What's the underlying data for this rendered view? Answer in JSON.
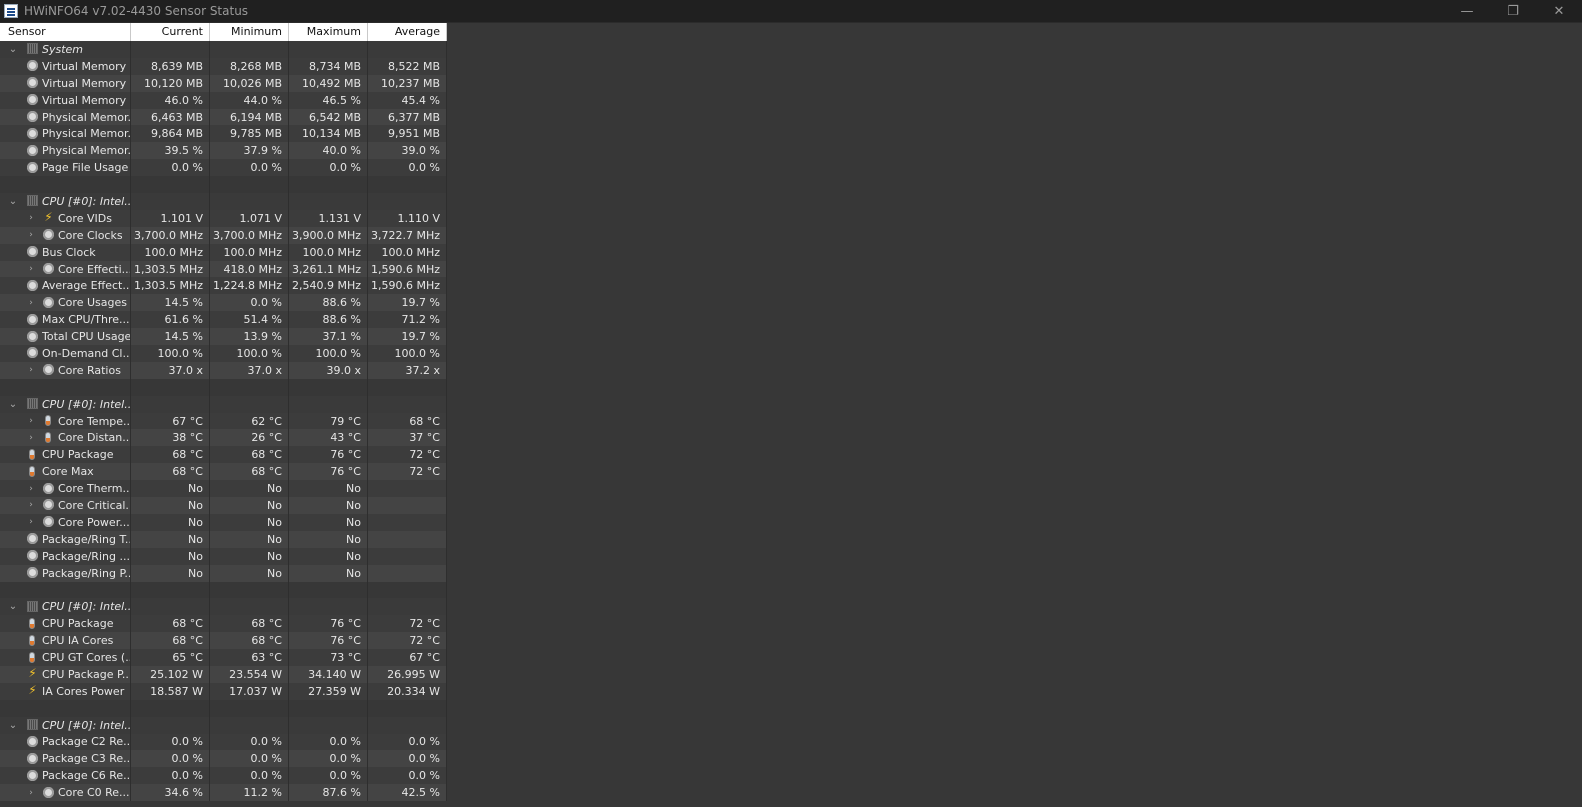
{
  "window": {
    "title": "HWiNFO64 v7.02-4430 Sensor Status",
    "minimize": "—",
    "maximize": "❐",
    "close": "✕"
  },
  "columns": {
    "sensor": "Sensor",
    "current": "Current",
    "minimum": "Minimum",
    "maximum": "Maximum",
    "average": "Average"
  },
  "rows": [
    {
      "kind": "group",
      "label": "System",
      "icon": "chip-icon"
    },
    {
      "kind": "item",
      "label": "Virtual Memory ...",
      "icon": "sensor-icon",
      "cur": "8,639 MB",
      "min": "8,268 MB",
      "max": "8,734 MB",
      "avg": "8,522 MB"
    },
    {
      "kind": "item",
      "label": "Virtual Memory ...",
      "icon": "sensor-icon",
      "cur": "10,120 MB",
      "min": "10,026 MB",
      "max": "10,492 MB",
      "avg": "10,237 MB"
    },
    {
      "kind": "item",
      "label": "Virtual Memory ...",
      "icon": "sensor-icon",
      "cur": "46.0 %",
      "min": "44.0 %",
      "max": "46.5 %",
      "avg": "45.4 %"
    },
    {
      "kind": "item",
      "label": "Physical Memor...",
      "icon": "sensor-icon",
      "cur": "6,463 MB",
      "min": "6,194 MB",
      "max": "6,542 MB",
      "avg": "6,377 MB"
    },
    {
      "kind": "item",
      "label": "Physical Memor...",
      "icon": "sensor-icon",
      "cur": "9,864 MB",
      "min": "9,785 MB",
      "max": "10,134 MB",
      "avg": "9,951 MB"
    },
    {
      "kind": "item",
      "label": "Physical Memor...",
      "icon": "sensor-icon",
      "cur": "39.5 %",
      "min": "37.9 %",
      "max": "40.0 %",
      "avg": "39.0 %"
    },
    {
      "kind": "item",
      "label": "Page File Usage",
      "icon": "sensor-icon",
      "cur": "0.0 %",
      "min": "0.0 %",
      "max": "0.0 %",
      "avg": "0.0 %"
    },
    {
      "kind": "blank"
    },
    {
      "kind": "group",
      "label": "CPU [#0]: Intel...",
      "icon": "chip-icon"
    },
    {
      "kind": "item",
      "label": "Core VIDs",
      "icon": "bolt-icon",
      "expand": true,
      "cur": "1.101 V",
      "min": "1.071 V",
      "max": "1.131 V",
      "avg": "1.110 V"
    },
    {
      "kind": "item",
      "label": "Core Clocks",
      "icon": "sensor-icon",
      "expand": true,
      "cur": "3,700.0 MHz",
      "min": "3,700.0 MHz",
      "max": "3,900.0 MHz",
      "avg": "3,722.7 MHz"
    },
    {
      "kind": "item",
      "label": "Bus Clock",
      "icon": "sensor-icon",
      "cur": "100.0 MHz",
      "min": "100.0 MHz",
      "max": "100.0 MHz",
      "avg": "100.0 MHz"
    },
    {
      "kind": "item",
      "label": "Core Effecti...",
      "icon": "sensor-icon",
      "expand": true,
      "cur": "1,303.5 MHz",
      "min": "418.0 MHz",
      "max": "3,261.1 MHz",
      "avg": "1,590.6 MHz"
    },
    {
      "kind": "item",
      "label": "Average Effect...",
      "icon": "sensor-icon",
      "cur": "1,303.5 MHz",
      "min": "1,224.8 MHz",
      "max": "2,540.9 MHz",
      "avg": "1,590.6 MHz"
    },
    {
      "kind": "item",
      "label": "Core Usages",
      "icon": "sensor-icon",
      "expand": true,
      "cur": "14.5 %",
      "min": "0.0 %",
      "max": "88.6 %",
      "avg": "19.7 %"
    },
    {
      "kind": "item",
      "label": "Max CPU/Thre...",
      "icon": "sensor-icon",
      "cur": "61.6 %",
      "min": "51.4 %",
      "max": "88.6 %",
      "avg": "71.2 %"
    },
    {
      "kind": "item",
      "label": "Total CPU Usage",
      "icon": "sensor-icon",
      "cur": "14.5 %",
      "min": "13.9 %",
      "max": "37.1 %",
      "avg": "19.7 %"
    },
    {
      "kind": "item",
      "label": "On-Demand Cl...",
      "icon": "sensor-icon",
      "cur": "100.0 %",
      "min": "100.0 %",
      "max": "100.0 %",
      "avg": "100.0 %"
    },
    {
      "kind": "item",
      "label": "Core Ratios",
      "icon": "sensor-icon",
      "expand": true,
      "cur": "37.0 x",
      "min": "37.0 x",
      "max": "39.0 x",
      "avg": "37.2 x"
    },
    {
      "kind": "blank"
    },
    {
      "kind": "group",
      "label": "CPU [#0]: Intel...",
      "icon": "chip-icon"
    },
    {
      "kind": "item",
      "label": "Core Tempe...",
      "icon": "thermometer-icon",
      "expand": true,
      "cur": "67 °C",
      "min": "62 °C",
      "max": "79 °C",
      "avg": "68 °C"
    },
    {
      "kind": "item",
      "label": "Core Distan...",
      "icon": "thermometer-icon",
      "expand": true,
      "cur": "38 °C",
      "min": "26 °C",
      "max": "43 °C",
      "avg": "37 °C"
    },
    {
      "kind": "item",
      "label": "CPU Package",
      "icon": "thermometer-icon",
      "cur": "68 °C",
      "min": "68 °C",
      "max": "76 °C",
      "avg": "72 °C"
    },
    {
      "kind": "item",
      "label": "Core Max",
      "icon": "thermometer-icon",
      "cur": "68 °C",
      "min": "68 °C",
      "max": "76 °C",
      "avg": "72 °C"
    },
    {
      "kind": "item",
      "label": "Core Therm...",
      "icon": "sensor-icon",
      "expand": true,
      "cur": "No",
      "min": "No",
      "max": "No",
      "avg": ""
    },
    {
      "kind": "item",
      "label": "Core Critical...",
      "icon": "sensor-icon",
      "expand": true,
      "cur": "No",
      "min": "No",
      "max": "No",
      "avg": ""
    },
    {
      "kind": "item",
      "label": "Core Power...",
      "icon": "sensor-icon",
      "expand": true,
      "cur": "No",
      "min": "No",
      "max": "No",
      "avg": ""
    },
    {
      "kind": "item",
      "label": "Package/Ring T...",
      "icon": "sensor-icon",
      "cur": "No",
      "min": "No",
      "max": "No",
      "avg": ""
    },
    {
      "kind": "item",
      "label": "Package/Ring ...",
      "icon": "sensor-icon",
      "cur": "No",
      "min": "No",
      "max": "No",
      "avg": ""
    },
    {
      "kind": "item",
      "label": "Package/Ring P...",
      "icon": "sensor-icon",
      "cur": "No",
      "min": "No",
      "max": "No",
      "avg": ""
    },
    {
      "kind": "blank"
    },
    {
      "kind": "group",
      "label": "CPU [#0]: Intel...",
      "icon": "chip-icon"
    },
    {
      "kind": "item",
      "label": "CPU Package",
      "icon": "thermometer-icon",
      "cur": "68 °C",
      "min": "68 °C",
      "max": "76 °C",
      "avg": "72 °C"
    },
    {
      "kind": "item",
      "label": "CPU IA Cores",
      "icon": "thermometer-icon",
      "cur": "68 °C",
      "min": "68 °C",
      "max": "76 °C",
      "avg": "72 °C"
    },
    {
      "kind": "item",
      "label": "CPU GT Cores (...",
      "icon": "thermometer-icon",
      "cur": "65 °C",
      "min": "63 °C",
      "max": "73 °C",
      "avg": "67 °C"
    },
    {
      "kind": "item",
      "label": "CPU Package P...",
      "icon": "bolt-icon",
      "cur": "25.102 W",
      "min": "23.554 W",
      "max": "34.140 W",
      "avg": "26.995 W"
    },
    {
      "kind": "item",
      "label": "IA Cores Power",
      "icon": "bolt-icon",
      "cur": "18.587 W",
      "min": "17.037 W",
      "max": "27.359 W",
      "avg": "20.334 W"
    },
    {
      "kind": "blank"
    },
    {
      "kind": "group",
      "label": "CPU [#0]: Intel...",
      "icon": "chip-icon"
    },
    {
      "kind": "item",
      "label": "Package C2 Re...",
      "icon": "sensor-icon",
      "cur": "0.0 %",
      "min": "0.0 %",
      "max": "0.0 %",
      "avg": "0.0 %"
    },
    {
      "kind": "item",
      "label": "Package C3 Re...",
      "icon": "sensor-icon",
      "cur": "0.0 %",
      "min": "0.0 %",
      "max": "0.0 %",
      "avg": "0.0 %"
    },
    {
      "kind": "item",
      "label": "Package C6 Re...",
      "icon": "sensor-icon",
      "cur": "0.0 %",
      "min": "0.0 %",
      "max": "0.0 %",
      "avg": "0.0 %"
    },
    {
      "kind": "item",
      "label": "Core C0 Re...",
      "icon": "sensor-icon",
      "expand": true,
      "cur": "34.6 %",
      "min": "11.2 %",
      "max": "87.6 %",
      "avg": "42.5 %"
    }
  ]
}
